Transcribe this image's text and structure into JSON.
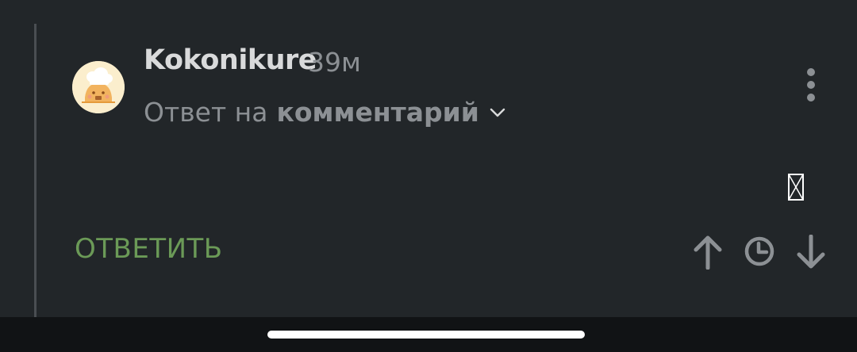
{
  "comment": {
    "author": "Kokonikure",
    "time": "39м",
    "reply_prefix": "Ответ на",
    "reply_target": "комментарий",
    "reply_button": "ОТВЕТИТЬ"
  },
  "icons": {
    "avatar": "chef-hat-avatar",
    "more": "more-vertical-icon",
    "expand": "chevron-down-icon",
    "broken": "broken-image-icon",
    "upvote": "arrow-up-icon",
    "clock": "clock-icon",
    "downvote": "arrow-down-icon"
  },
  "colors": {
    "background": "#222629",
    "author": "#d9dadb",
    "muted": "#8c9094",
    "reply_button": "#6b9a57",
    "action_icons": "#8c9094",
    "navbar": "#111315"
  }
}
